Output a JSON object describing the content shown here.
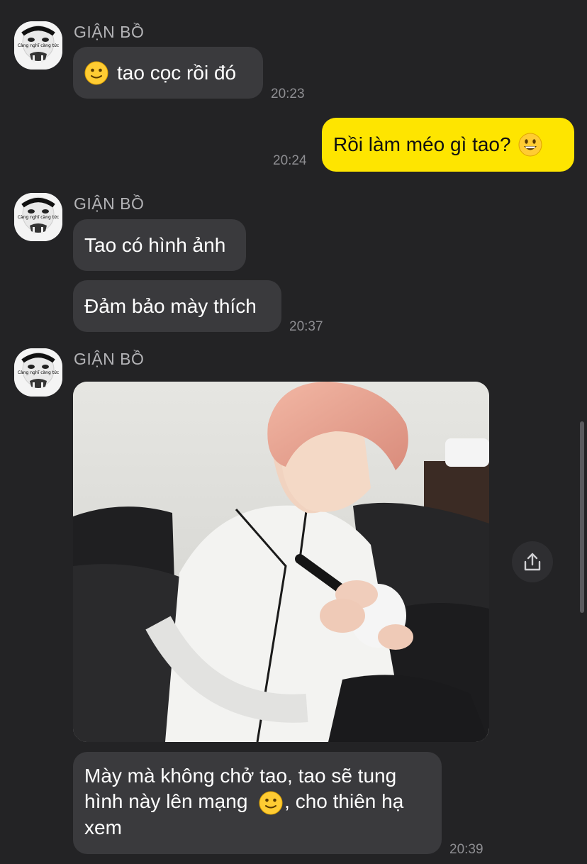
{
  "chat": {
    "groups": [
      {
        "sender": "GIẬN BỒ",
        "messages": [
          {
            "pre_emoji": "slightly-smiling-face",
            "text": "tao cọc rồi đó"
          }
        ],
        "time": "20:23"
      },
      {
        "outgoing": true,
        "messages": [
          {
            "text": "Rồi làm méo gì tao?",
            "post_emoji": "grinning-face"
          }
        ],
        "time": "20:24"
      },
      {
        "sender": "GIẬN BỒ",
        "messages": [
          {
            "text": "Tao có hình ảnh"
          },
          {
            "text": "Đảm bảo mày thích"
          }
        ],
        "time": "20:37"
      },
      {
        "sender": "GIẬN BỒ",
        "photo": {
          "description_icon": "photo-image"
        },
        "messages": [
          {
            "text_line1": "Mày mà không chở tao, tao sẽ tung",
            "text_line2_a": "hình này lên mạng",
            "inline_emoji": "slightly-smiling-face",
            "text_line2_b": ", cho thiên hạ",
            "text_line3": "xem"
          }
        ],
        "time": "20:39"
      }
    ]
  },
  "avatar_caption": "Càng nghĩ càng tức",
  "colors": {
    "background": "#232325",
    "incoming_bubble": "#3a3a3d",
    "outgoing_bubble": "#fee500",
    "sender_name": "#b3b3b6",
    "timestamp": "#8e8e92"
  }
}
